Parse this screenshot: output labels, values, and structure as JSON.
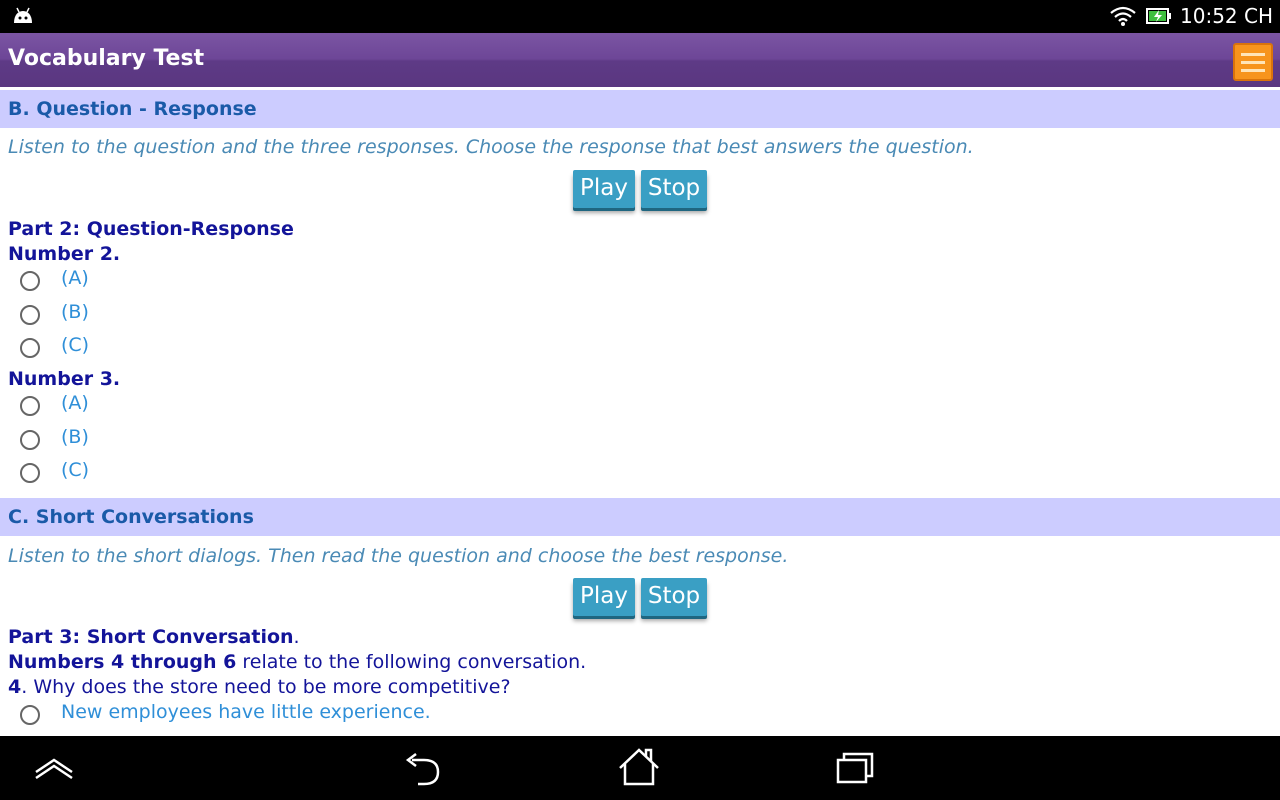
{
  "status_bar": {
    "time": "10:52 CH"
  },
  "app": {
    "title": "Vocabulary Test"
  },
  "section_b": {
    "header": "B. Question - Response",
    "instructions": "Listen to the question and the three responses. Choose the response that best answers the question.",
    "play_label": "Play",
    "stop_label": "Stop",
    "part_title": "Part 2: Question-Response",
    "questions": [
      {
        "label": "Number 2.",
        "options": [
          "(A)",
          "(B)",
          "(C)"
        ]
      },
      {
        "label": "Number 3.",
        "options": [
          "(A)",
          "(B)",
          "(C)"
        ]
      }
    ]
  },
  "section_c": {
    "header": "C. Short Conversations",
    "instructions": "Listen to the short dialogs. Then read the question and choose the best response.",
    "play_label": "Play",
    "stop_label": "Stop",
    "part_title": "Part 3: Short Conversation",
    "part_title_suffix": ".",
    "range_bold": "Numbers 4 through 6",
    "range_text": " relate to the following conversation.",
    "question_number": "4",
    "question_text": ". Why does the store need to be more competitive?",
    "options": [
      "New employees have little experience."
    ]
  },
  "icons": {
    "status_left": "android-debug-icon",
    "wifi": "wifi-icon",
    "battery": "battery-charging-icon",
    "menu": "menu-icon",
    "nav": [
      "recents-up-icon",
      "back-icon",
      "home-icon",
      "recent-apps-icon"
    ]
  },
  "colors": {
    "action_bar": "#6d4697",
    "section_header_bg": "#ccccff",
    "button_bg": "#3a9fc4",
    "menu_button": "#f7941d",
    "heading_text": "#131499",
    "option_text": "#2f8fd8"
  }
}
